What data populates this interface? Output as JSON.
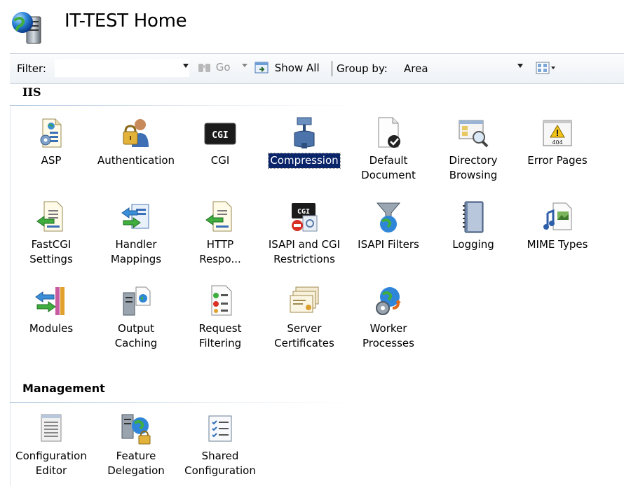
{
  "window": {
    "title": "IT-TEST Home"
  },
  "toolbar": {
    "filter_label": "Filter:",
    "filter_value": "",
    "go_label": "Go",
    "show_all_label": "Show All",
    "group_by_label": "Group by:",
    "group_by_value": "Area"
  },
  "sections": {
    "iis": {
      "title": "IIS",
      "items": [
        {
          "label": "ASP",
          "icon": "asp-icon"
        },
        {
          "label": "Authentication",
          "icon": "authentication-icon"
        },
        {
          "label": "CGI",
          "icon": "cgi-icon"
        },
        {
          "label": "Compression",
          "icon": "compression-icon",
          "selected": true
        },
        {
          "label": "Default\nDocument",
          "icon": "default-document-icon"
        },
        {
          "label": "Directory\nBrowsing",
          "icon": "directory-browsing-icon"
        },
        {
          "label": "Error Pages",
          "icon": "error-pages-icon",
          "badge": "404"
        },
        {
          "label": "FastCGI\nSettings",
          "icon": "fastcgi-icon"
        },
        {
          "label": "Handler\nMappings",
          "icon": "handler-mappings-icon"
        },
        {
          "label": "HTTP\nRespo...",
          "icon": "http-response-icon"
        },
        {
          "label": "ISAPI and CGI\nRestrictions",
          "icon": "isapi-cgi-restrictions-icon"
        },
        {
          "label": "ISAPI Filters",
          "icon": "isapi-filters-icon"
        },
        {
          "label": "Logging",
          "icon": "logging-icon"
        },
        {
          "label": "MIME Types",
          "icon": "mime-types-icon"
        },
        {
          "label": "Modules",
          "icon": "modules-icon"
        },
        {
          "label": "Output\nCaching",
          "icon": "output-caching-icon"
        },
        {
          "label": "Request\nFiltering",
          "icon": "request-filtering-icon"
        },
        {
          "label": "Server\nCertificates",
          "icon": "server-certificates-icon"
        },
        {
          "label": "Worker\nProcesses",
          "icon": "worker-processes-icon"
        }
      ]
    },
    "management": {
      "title": "Management",
      "items": [
        {
          "label": "Configuration\nEditor",
          "icon": "configuration-editor-icon"
        },
        {
          "label": "Feature\nDelegation",
          "icon": "feature-delegation-icon"
        },
        {
          "label": "Shared\nConfiguration",
          "icon": "shared-configuration-icon"
        }
      ]
    }
  },
  "colors": {
    "selection": "#0a246a",
    "accent_blue": "#2f76c8",
    "toolbar_border": "#c9d3de"
  }
}
